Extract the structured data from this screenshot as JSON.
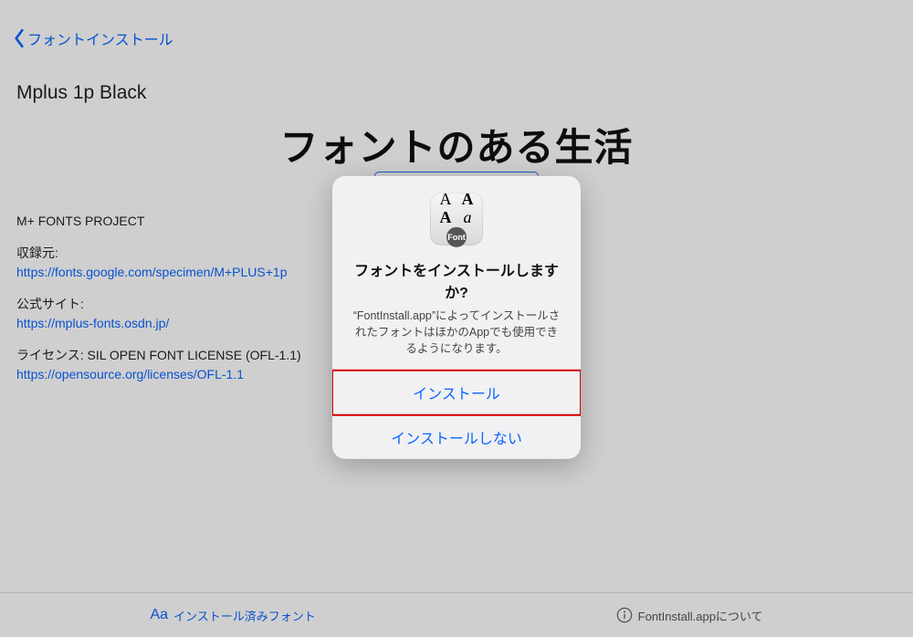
{
  "nav": {
    "back_label": "フォントインストール"
  },
  "font": {
    "name": "Mplus 1p Black",
    "sample_text": "フォントのある生活",
    "install_button": "インストール"
  },
  "meta": {
    "project": "M+ FONTS PROJECT",
    "source_label": "収録元:",
    "source_url": "https://fonts.google.com/specimen/M+PLUS+1p",
    "official_label": "公式サイト:",
    "official_url": "https://mplus-fonts.osdn.jp/",
    "license_label": "ライセンス: SIL OPEN FONT LICENSE (OFL-1.1)",
    "license_url": "https://opensource.org/licenses/OFL-1.1"
  },
  "footer": {
    "installed_prefix": "Aa",
    "installed_label": "インストール済みフォント",
    "about_label": "FontInstall.appについて"
  },
  "modal": {
    "title": "フォントをインストールしますか?",
    "body": "“FontInstall.app”によってインストールされたフォントはほかのAppでも使用できるようになります。",
    "install": "インストール",
    "cancel": "インストールしない",
    "icon_badge": "Font"
  }
}
